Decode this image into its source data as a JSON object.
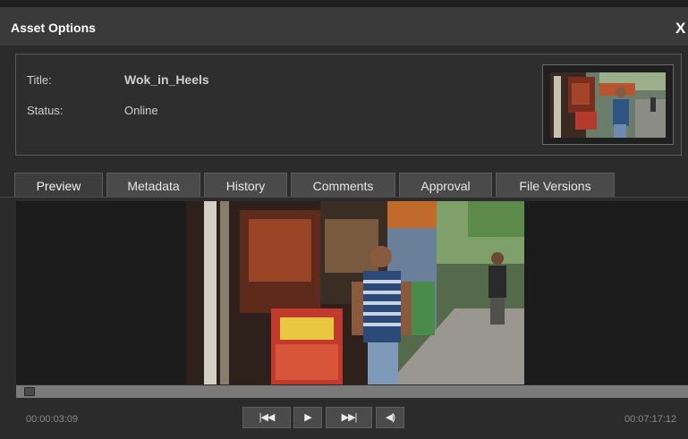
{
  "dialog": {
    "title": "Asset Options",
    "close_label": "X"
  },
  "asset": {
    "title_label": "Title:",
    "title_value": "Wok_in_Heels",
    "status_label": "Status:",
    "status_value": "Online"
  },
  "tabs": [
    {
      "label": "Preview",
      "active": true
    },
    {
      "label": "Metadata",
      "active": false
    },
    {
      "label": "History",
      "active": false
    },
    {
      "label": "Comments",
      "active": false
    },
    {
      "label": "Approval",
      "active": false
    },
    {
      "label": "File Versions",
      "active": false
    }
  ],
  "player": {
    "current_time": "00:00:03:09",
    "duration": "00:07:17:12",
    "progress": 0.007,
    "controls": {
      "rewind_icon": "skip-back-icon",
      "play_icon": "play-icon",
      "forward_icon": "skip-forward-icon",
      "volume_icon": "volume-icon"
    }
  },
  "colors": {
    "title_bar": "#3a3a3a",
    "background": "#2b2b2b",
    "tab": "#4a4a4a",
    "scrub_track": "#7a7a7a"
  }
}
